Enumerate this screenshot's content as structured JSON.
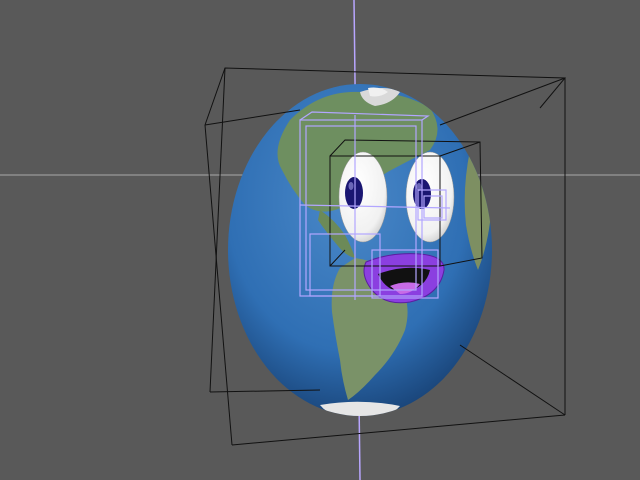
{
  "viewport": {
    "background_color": "#595959",
    "axis_horizontal_color": "#a9a9a9",
    "axis_vertical_color": "#b8a6ff",
    "bounding_box_color": "#111111",
    "selection_cage_color": "#b2a6ff"
  },
  "scene": {
    "model": {
      "ocean_color": "#2f6fb4",
      "land_color": "#6e8f60",
      "ice_color": "#e6e6e6"
    },
    "eyes": {
      "sclera_color": "#f5f5f5",
      "pupil_color": "#1a1672"
    },
    "mouth": {
      "lip_color": "#8b3fe0",
      "inner_color": "#111111",
      "tongue_color": "#c86be6"
    }
  }
}
